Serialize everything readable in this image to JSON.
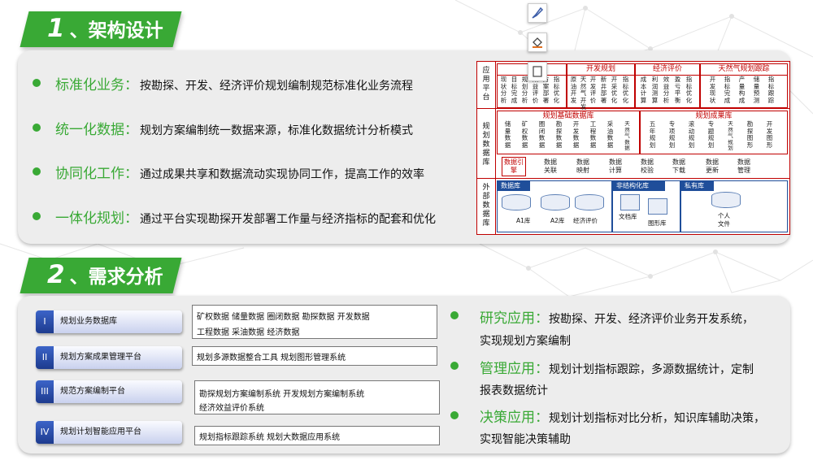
{
  "section1": {
    "num": "1",
    "title": "、架构设计"
  },
  "section2": {
    "num": "2",
    "title": "、需求分析"
  },
  "bullets": [
    {
      "head": "标准化业务：",
      "text": "按勘探、开发、经济评价规划编制规范标准化业务流程"
    },
    {
      "head": "统一化数据：",
      "text": "规划方案编制统一数据来源，标准化数据统计分析模式"
    },
    {
      "head": "协同化工作：",
      "text": "通过成果共享和数据流动实现协同工作，提高工作的效率"
    },
    {
      "head": "一体化规划：",
      "text": "通过平台实现勘探开发部署工作量与经济指标的配套和优化"
    }
  ],
  "arch": {
    "layers": [
      "应用平台",
      "规划数据库",
      "外部数据库"
    ],
    "apps": [
      {
        "title": "勘",
        "items": [
          "现状分析",
          "目标完成",
          "规划分析",
          "效益评价",
          "方案部署",
          "指标优化"
        ]
      },
      {
        "title": "开发规划",
        "items": [
          "原油开发",
          "天然气开发",
          "开发评价",
          "新井部署",
          "开采优化",
          "指标优化"
        ]
      },
      {
        "title": "经济评价",
        "items": [
          "成本计算",
          "利润测算",
          "效益分析",
          "盈亏平衡",
          "指标优化"
        ]
      },
      {
        "title": "天然气规划跟踪",
        "items": [
          "开发现状",
          "指标完成",
          "产量构成",
          "储量预测",
          "指标跟踪"
        ]
      }
    ],
    "base_title": "规划基础数据库",
    "base_items": [
      "储量数据",
      "矿权数据",
      "圈闭数据",
      "勘探数据",
      "开发数据",
      "工程数据",
      "采油数据",
      "天然气数据"
    ],
    "result_title": "规划成果库",
    "result_items": [
      "五年规划",
      "专项规划",
      "滚动规划",
      "专题规划",
      "天然气规划",
      "勘探图形",
      "开发图形"
    ],
    "engine_label": "数据引擎",
    "engine_items": [
      "数据关联",
      "数据映射",
      "数据计算",
      "数据校验",
      "数据下载",
      "数据更新",
      "数据管理"
    ],
    "db_title": "数据库",
    "db_items": [
      "A1库",
      "A2库",
      "经济评价"
    ],
    "nonstruct_title": "非结构化库",
    "nonstruct_items": [
      "文档库",
      "图形库"
    ],
    "private_title": "私有库",
    "private_items": [
      "个人",
      "文件"
    ]
  },
  "tools": [
    "brush-icon",
    "fill-icon",
    "page-icon"
  ],
  "req_rows": [
    {
      "roman": "I",
      "label": "规划业务数据库",
      "lines": [
        "矿权数据    储量数据    圈闭数据    勘探数据    开发数据",
        "工程数据    采油数据    经济数据"
      ]
    },
    {
      "roman": "II",
      "label": "规划方案成果管理平台",
      "lines": [
        "规划多源数据整合工具    规划图形管理系统"
      ]
    },
    {
      "roman": "III",
      "label": "规范方案编制平台",
      "lines": [
        "勘探规划方案编制系统    开发规划方案编制系统",
        "经济效益评价系统"
      ]
    },
    {
      "roman": "IV",
      "label": "规划计划智能应用平台",
      "lines": [
        "规划指标跟踪系统    规划大数据应用系统"
      ]
    }
  ],
  "req_bullets": [
    {
      "head": "研究应用：",
      "text1": "按勘探、开发、经济评价业务开发系统，",
      "text2": "实现规划方案编制"
    },
    {
      "head": "管理应用：",
      "text1": "规划计划指标跟踪，多源数据统计，定制",
      "text2": "报表数据统计"
    },
    {
      "head": "决策应用：",
      "text1": "规划计划指标对比分析，知识库辅助决策，",
      "text2": "实现智能决策辅助"
    }
  ]
}
